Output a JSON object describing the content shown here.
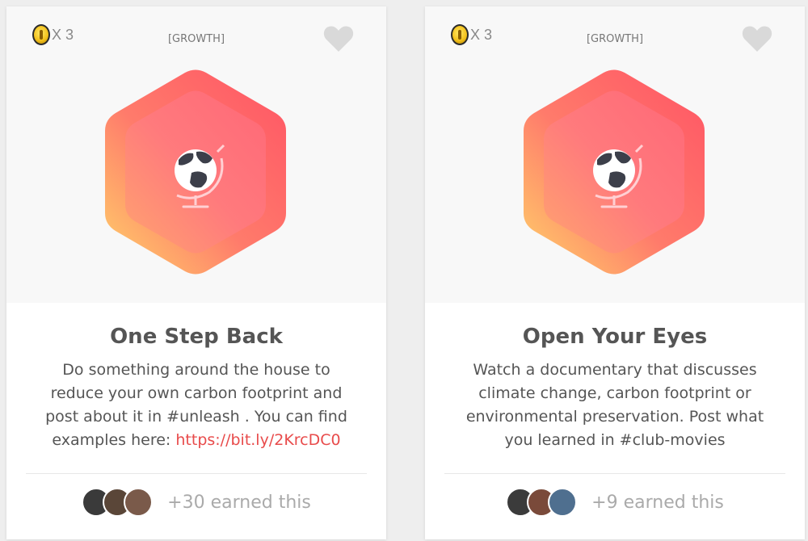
{
  "cards": [
    {
      "coins": "X 3",
      "category": "[GROWTH]",
      "title": "One Step Back",
      "description": "Do something around the house to reduce your own carbon footprint and post about it in #unleash . You can find examples here: ",
      "link": "https://bit.ly/2KrcDC0",
      "earned": "+30 earned this",
      "icon": "globe-icon",
      "avatar_colors": [
        "#3a3a3a",
        "#5a4638",
        "#7a5a4a"
      ]
    },
    {
      "coins": "X 3",
      "category": "[GROWTH]",
      "title": "Open Your Eyes",
      "description": "Watch a documentary that discusses climate change, carbon footprint or environmental preservation. Post what you learned in #club-movies",
      "earned": "+9 earned this",
      "icon": "globe-icon",
      "avatar_colors": [
        "#3b3b3b",
        "#7a4a3a",
        "#4f6f8f"
      ]
    }
  ],
  "colors": {
    "badge_gradient_start": "#ffd36a",
    "badge_gradient_mid": "#ff7b6b",
    "badge_gradient_end": "#ff5465",
    "link": "#e84b4b",
    "heart": "#d9d9d9"
  }
}
